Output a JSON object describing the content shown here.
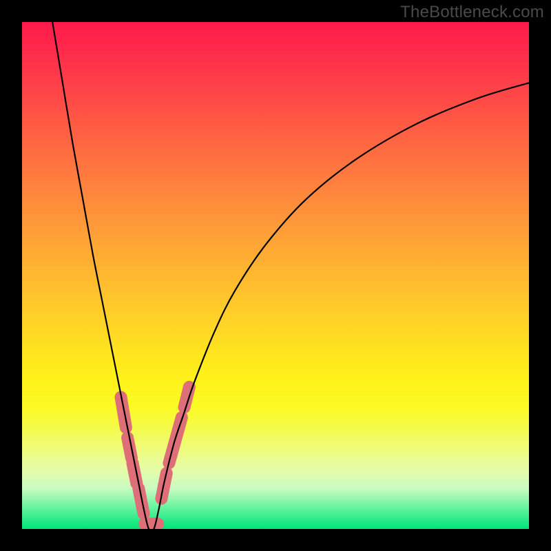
{
  "watermark": "TheBottleneck.com",
  "chart_data": {
    "type": "line",
    "title": "",
    "xlabel": "",
    "ylabel": "",
    "xlim": [
      0,
      100
    ],
    "ylim": [
      0,
      100
    ],
    "grid": false,
    "legend": false,
    "series": [
      {
        "name": "bottleneck-curve",
        "color": "#000000",
        "x": [
          6,
          8,
          10,
          12,
          14,
          16,
          18,
          20,
          21,
          22,
          23,
          24,
          25,
          26,
          27,
          28,
          30,
          32,
          34,
          38,
          42,
          48,
          56,
          66,
          78,
          90,
          100
        ],
        "y": [
          100,
          88,
          76,
          65,
          54,
          44,
          34,
          24,
          19,
          14,
          9,
          4,
          0,
          0,
          4,
          9,
          17,
          23,
          29,
          39,
          47,
          56,
          65,
          73,
          80,
          85,
          88
        ]
      }
    ],
    "markers": [
      {
        "name": "highlight-clusters",
        "color": "#de6e77",
        "shape": "rounded-segment",
        "points": [
          {
            "x0": 19.5,
            "x1": 20.5,
            "y0": 26,
            "y1": 20
          },
          {
            "x0": 20.8,
            "x1": 21.6,
            "y0": 18,
            "y1": 14
          },
          {
            "x0": 21.8,
            "x1": 22.6,
            "y0": 13,
            "y1": 9
          },
          {
            "x0": 23.0,
            "x1": 24.0,
            "y0": 8,
            "y1": 3
          },
          {
            "x0": 24.2,
            "x1": 26.8,
            "y0": 1,
            "y1": 1
          },
          {
            "x0": 27.5,
            "x1": 28.5,
            "y0": 6,
            "y1": 11
          },
          {
            "x0": 29.0,
            "x1": 31.5,
            "y0": 13,
            "y1": 22
          },
          {
            "x0": 32.0,
            "x1": 33.0,
            "y0": 24,
            "y1": 28
          }
        ]
      }
    ],
    "background_gradient": {
      "type": "vertical",
      "stops": [
        {
          "pos": 0.0,
          "color": "#ff1a4b"
        },
        {
          "pos": 0.5,
          "color": "#ffb531"
        },
        {
          "pos": 0.75,
          "color": "#fff119"
        },
        {
          "pos": 0.92,
          "color": "#c9fbc1"
        },
        {
          "pos": 1.0,
          "color": "#00e676"
        }
      ]
    }
  }
}
